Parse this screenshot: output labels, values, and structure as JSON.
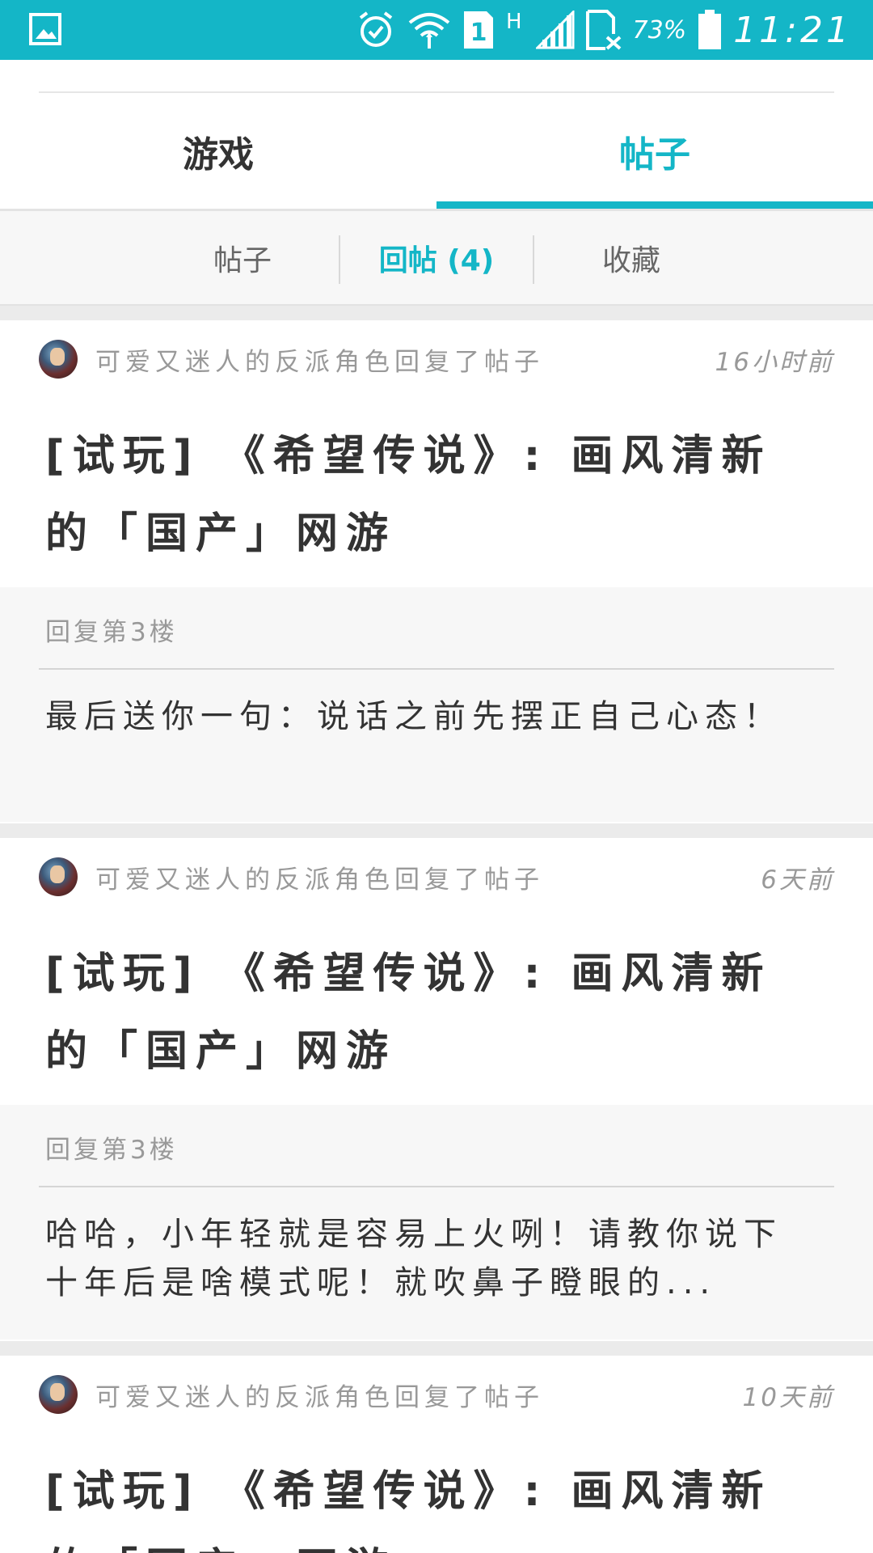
{
  "status_bar": {
    "left_icon": "image-icon",
    "icons": [
      "alarm-icon",
      "wifi-icon",
      "sim-1-icon",
      "signal-icon",
      "no-sim-icon",
      "battery-icon"
    ],
    "network_type": "H",
    "sim_label": "1",
    "battery_percent": "73%",
    "time": "11:21",
    "color": "#14b6c7"
  },
  "main_tabs": [
    {
      "label": "游戏",
      "active": false
    },
    {
      "label": "帖子",
      "active": true
    }
  ],
  "sub_tabs": [
    {
      "label": "帖子",
      "active": false
    },
    {
      "label": "回帖 (4)",
      "active": true
    },
    {
      "label": "收藏",
      "active": false
    }
  ],
  "items": [
    {
      "author_action": "可爱又迷人的反派角色回复了帖子",
      "time": "16小时前",
      "title": "[试玩] 《希望传说》: 画风清新的「国产」网游",
      "floor": "回复第3楼",
      "reply": "最后送你一句：说话之前先摆正自己心态！"
    },
    {
      "author_action": "可爱又迷人的反派角色回复了帖子",
      "time": "6天前",
      "title": "[试玩] 《希望传说》: 画风清新的「国产」网游",
      "floor": "回复第3楼",
      "reply": "哈哈，小年轻就是容易上火咧！请教你说下十年后是啥模式呢！就吹鼻子瞪眼的..."
    },
    {
      "author_action": "可爱又迷人的反派角色回复了帖子",
      "time": "10天前",
      "title": "[试玩] 《希望传说》: 画风清新的「国产」网游"
    }
  ],
  "accent_color": "#14b6c7"
}
